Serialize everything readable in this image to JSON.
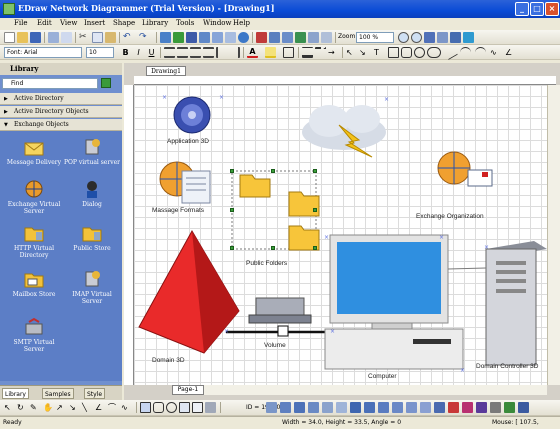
{
  "window": {
    "title": "EDraw Network Diagrammer (Trial Version) - [Drawing1]"
  },
  "menu": [
    "File",
    "Edit",
    "View",
    "Insert",
    "Shape",
    "Library",
    "Tools",
    "Window",
    "Help"
  ],
  "toolbar_top": {
    "zoom_label": "Zoom",
    "zoom_value": "100 %"
  },
  "toolbar_format": {
    "font": "Font: Arial",
    "size": "10"
  },
  "library": {
    "title": "Library",
    "find_placeholder": "Find",
    "sections": [
      "Active Directory",
      "Active Directory Objects",
      "Exchange Objects"
    ],
    "items": [
      {
        "label": "Message Delivery",
        "icon": "envelope-icon"
      },
      {
        "label": "POP virtual server",
        "icon": "pop-server-icon"
      },
      {
        "label": "Exchange Virtual Server",
        "icon": "exchange-server-icon"
      },
      {
        "label": "Dialog",
        "icon": "dialog-icon"
      },
      {
        "label": "HTTP Virtual Directory",
        "icon": "folder-icon"
      },
      {
        "label": "Public Store",
        "icon": "folder-icon"
      },
      {
        "label": "Mailbox Store",
        "icon": "mailbox-icon"
      },
      {
        "label": "IMAP Virtual Server",
        "icon": "imap-server-icon"
      },
      {
        "label": "SMTP Virtual Server",
        "icon": "smtp-server-icon"
      }
    ],
    "tabs": [
      "Library",
      "Samples",
      "Style"
    ]
  },
  "document": {
    "tab": "Drawing1",
    "page_tab": "Page-1"
  },
  "diagram": {
    "labels": {
      "application": "Application 3D",
      "message_formats": "Massage Formats",
      "public_folders": "Public Folders",
      "exchange_org": "Exchange Organization",
      "domain": "Domain 3D",
      "volume": "Volume",
      "computer": "Computer",
      "domain_controller": "Domain Controller 3D"
    }
  },
  "status": {
    "ready": "Ready",
    "id": "ID = 19200",
    "size": "Width = 34.0, Height = 33.5, Angle = 0",
    "mouse": "Mouse: [ 107.5,"
  },
  "colors": {
    "titlebar": "#0a4bd6",
    "library_bg": "#5c7ec6",
    "grid": "#dcdcdc"
  }
}
